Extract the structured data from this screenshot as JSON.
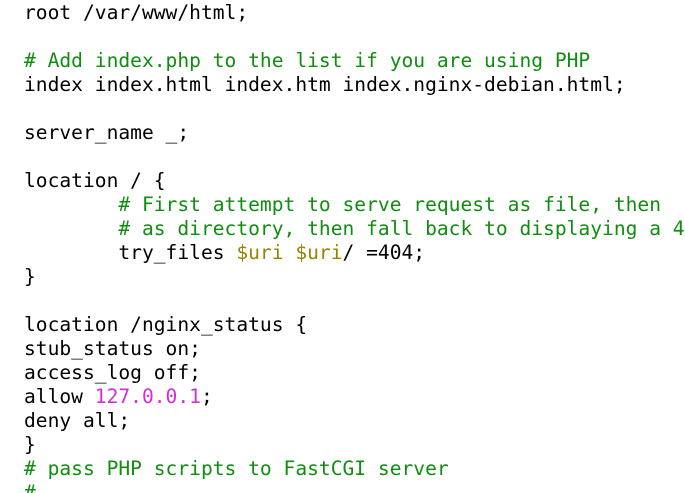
{
  "terminal": {
    "colors": {
      "background": "#ffffff",
      "text": "#000000",
      "comment": "#0f8d0f",
      "variable": "#9a8300",
      "number": "#d42fd4"
    },
    "lines": [
      {
        "segments": [
          {
            "text": "root /var/www/html;",
            "kind": "text"
          }
        ]
      },
      {
        "segments": []
      },
      {
        "segments": [
          {
            "text": "# Add index.php to the list if you are using PHP",
            "kind": "comment"
          }
        ]
      },
      {
        "segments": [
          {
            "text": "index index.html index.htm index.nginx-debian.html;",
            "kind": "text"
          }
        ]
      },
      {
        "segments": []
      },
      {
        "segments": [
          {
            "text": "server_name _;",
            "kind": "text"
          }
        ]
      },
      {
        "segments": []
      },
      {
        "segments": [
          {
            "text": "location / {",
            "kind": "text"
          }
        ]
      },
      {
        "segments": [
          {
            "text": "        # First attempt to serve request as file, then",
            "kind": "comment"
          }
        ]
      },
      {
        "segments": [
          {
            "text": "        # as directory, then fall back to displaying a 4",
            "kind": "comment"
          }
        ]
      },
      {
        "segments": [
          {
            "text": "        try_files ",
            "kind": "text"
          },
          {
            "text": "$uri",
            "kind": "variable"
          },
          {
            "text": " ",
            "kind": "text"
          },
          {
            "text": "$uri",
            "kind": "variable"
          },
          {
            "text": "/ =404;",
            "kind": "text"
          }
        ]
      },
      {
        "segments": [
          {
            "text": "}",
            "kind": "text"
          }
        ]
      },
      {
        "segments": []
      },
      {
        "segments": [
          {
            "text": "location /nginx_status {",
            "kind": "text"
          }
        ]
      },
      {
        "segments": [
          {
            "text": "stub_status on;",
            "kind": "text"
          }
        ]
      },
      {
        "segments": [
          {
            "text": "access_log off;",
            "kind": "text"
          }
        ]
      },
      {
        "segments": [
          {
            "text": "allow ",
            "kind": "text"
          },
          {
            "text": "127.0.0.1",
            "kind": "number"
          },
          {
            "text": ";",
            "kind": "text"
          }
        ]
      },
      {
        "segments": [
          {
            "text": "deny all;",
            "kind": "text"
          }
        ]
      },
      {
        "segments": [
          {
            "text": "}",
            "kind": "text"
          }
        ]
      },
      {
        "segments": [
          {
            "text": "# pass PHP scripts to FastCGI server",
            "kind": "comment"
          }
        ]
      },
      {
        "segments": [
          {
            "text": "#",
            "kind": "comment"
          }
        ]
      }
    ]
  }
}
